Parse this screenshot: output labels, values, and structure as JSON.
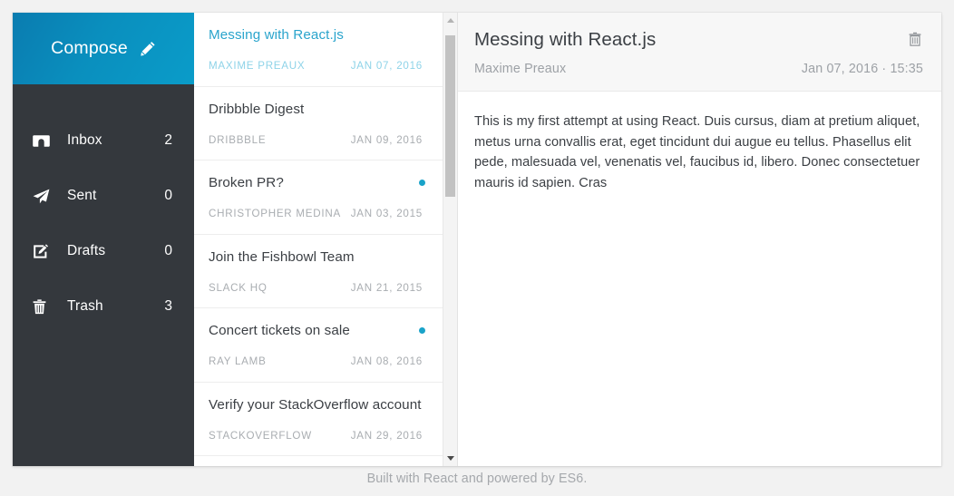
{
  "sidebar": {
    "compose": {
      "label": "Compose",
      "icon": "pencil-icon"
    },
    "items": [
      {
        "label": "Inbox",
        "count": "2",
        "icon": "inbox-icon"
      },
      {
        "label": "Sent",
        "count": "0",
        "icon": "paper-plane-icon"
      },
      {
        "label": "Drafts",
        "count": "0",
        "icon": "edit-square-icon"
      },
      {
        "label": "Trash",
        "count": "3",
        "icon": "trash-icon"
      }
    ]
  },
  "email_list": {
    "emails": [
      {
        "subject": "Messing with React.js",
        "from": "MAXIME PREAUX",
        "date": "JAN 07, 2016",
        "selected": true,
        "unread": false
      },
      {
        "subject": "Dribbble Digest",
        "from": "DRIBBBLE",
        "date": "JAN 09, 2016",
        "selected": false,
        "unread": false
      },
      {
        "subject": "Broken PR?",
        "from": "CHRISTOPHER MEDINA",
        "date": "JAN 03, 2015",
        "selected": false,
        "unread": true
      },
      {
        "subject": "Join the Fishbowl Team",
        "from": "SLACK HQ",
        "date": "JAN 21, 2015",
        "selected": false,
        "unread": false
      },
      {
        "subject": "Concert tickets on sale",
        "from": "RAY LAMB",
        "date": "JAN 08, 2016",
        "selected": false,
        "unread": true
      },
      {
        "subject": "Verify your StackOverflow account",
        "from": "STACKOVERFLOW",
        "date": "JAN 29, 2016",
        "selected": false,
        "unread": false
      }
    ],
    "scrollbar": {
      "up_arrow": "scroll-up-icon",
      "down_arrow": "scroll-down-icon"
    }
  },
  "reading_pane": {
    "subject": "Messing with React.js",
    "from": "Maxime Preaux",
    "date": "Jan 07, 2016 · 15:35",
    "delete_icon": "trash-icon",
    "body": "This is my first attempt at using React. Duis cursus, diam at pretium aliquet, metus urna convallis erat, eget tincidunt dui augue eu tellus. Phasellus elit pede, malesuada vel, venenatis vel, faucibus id, libero. Donec consectetuer mauris id sapien. Cras"
  },
  "footer": {
    "text": "Built with React and powered by ES6."
  },
  "colors": {
    "accent": "#0a8fbe",
    "sidebar_bg": "#34383d",
    "unread_dot": "#19a3c9",
    "selected_text": "#2aa4cc"
  }
}
